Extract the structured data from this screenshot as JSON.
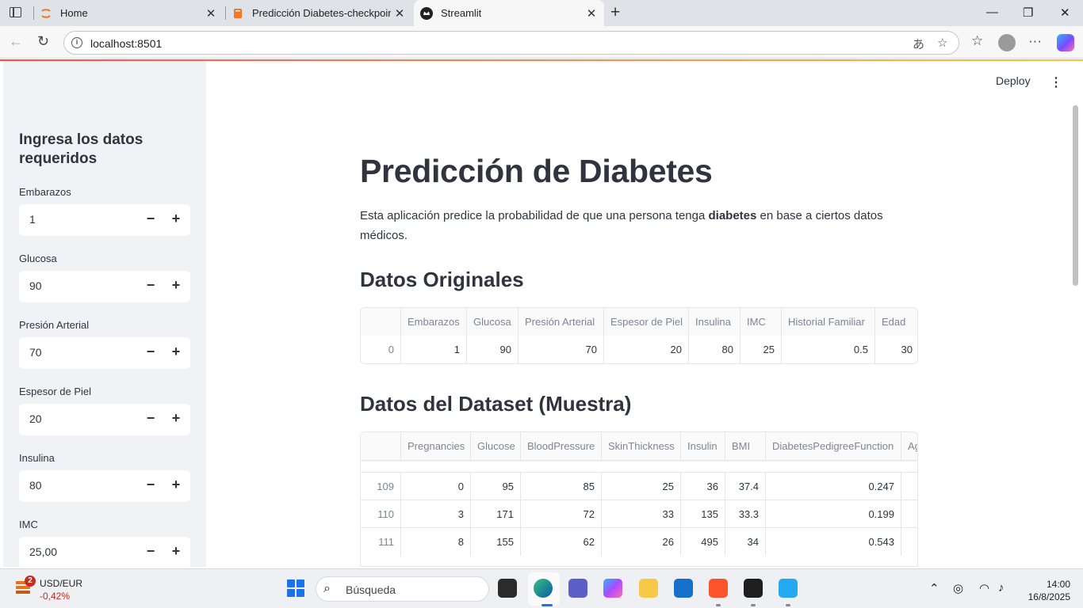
{
  "browser": {
    "tabs": [
      {
        "title": "Home"
      },
      {
        "title": "Predicción Diabetes-checkpoint"
      },
      {
        "title": "Streamlit"
      }
    ],
    "url": "localhost:8501",
    "close_glyph": "✕",
    "new_tab_glyph": "+",
    "window_controls": {
      "minimize": "—",
      "maximize": "❐",
      "close": "✕"
    }
  },
  "header": {
    "deploy_label": "Deploy",
    "menu_glyph": "⋮"
  },
  "sidebar": {
    "title": "Ingresa los datos requeridos",
    "fields": [
      {
        "label": "Embarazos",
        "value": "1"
      },
      {
        "label": "Glucosa",
        "value": "90"
      },
      {
        "label": "Presión Arterial",
        "value": "70"
      },
      {
        "label": "Espesor de Piel",
        "value": "20"
      },
      {
        "label": "Insulina",
        "value": "80"
      },
      {
        "label": "IMC",
        "value": "25,00"
      }
    ],
    "minus": "−",
    "plus": "+"
  },
  "main": {
    "title": "Predicción de Diabetes",
    "intro_before": "Esta aplicación predice la probabilidad de que una persona tenga ",
    "intro_bold": "diabetes",
    "intro_after": " en base a ciertos datos médicos.",
    "section1": "Datos Originales",
    "section2": "Datos del Dataset (Muestra)"
  },
  "original_table": {
    "columns": [
      "",
      "Embarazos",
      "Glucosa",
      "Presión Arterial",
      "Espesor de Piel",
      "Insulina",
      "IMC",
      "Historial Familiar",
      "Edad"
    ],
    "rows": [
      [
        "0",
        "1",
        "90",
        "70",
        "20",
        "80",
        "25",
        "0.5",
        "30"
      ]
    ]
  },
  "dataset_table": {
    "columns": [
      "",
      "Pregnancies",
      "Glucose",
      "BloodPressure",
      "SkinThickness",
      "Insulin",
      "BMI",
      "DiabetesPedigreeFunction",
      "Ag"
    ],
    "rows": [
      [
        "109",
        "0",
        "95",
        "85",
        "25",
        "36",
        "37.4",
        "0.247",
        ""
      ],
      [
        "110",
        "3",
        "171",
        "72",
        "33",
        "135",
        "33.3",
        "0.199",
        ""
      ],
      [
        "111",
        "8",
        "155",
        "62",
        "26",
        "495",
        "34",
        "0.543",
        ""
      ]
    ]
  },
  "taskbar": {
    "badge": "2",
    "currency": "USD/EUR",
    "change": "-0,42%",
    "search_label": "Búsqueda",
    "time": "14:00",
    "date": "16/8/2025"
  },
  "colors": {
    "accent": "#ff4b4b",
    "sidebar_bg": "#f0f2f6",
    "text": "#31333f",
    "muted": "#808495"
  }
}
